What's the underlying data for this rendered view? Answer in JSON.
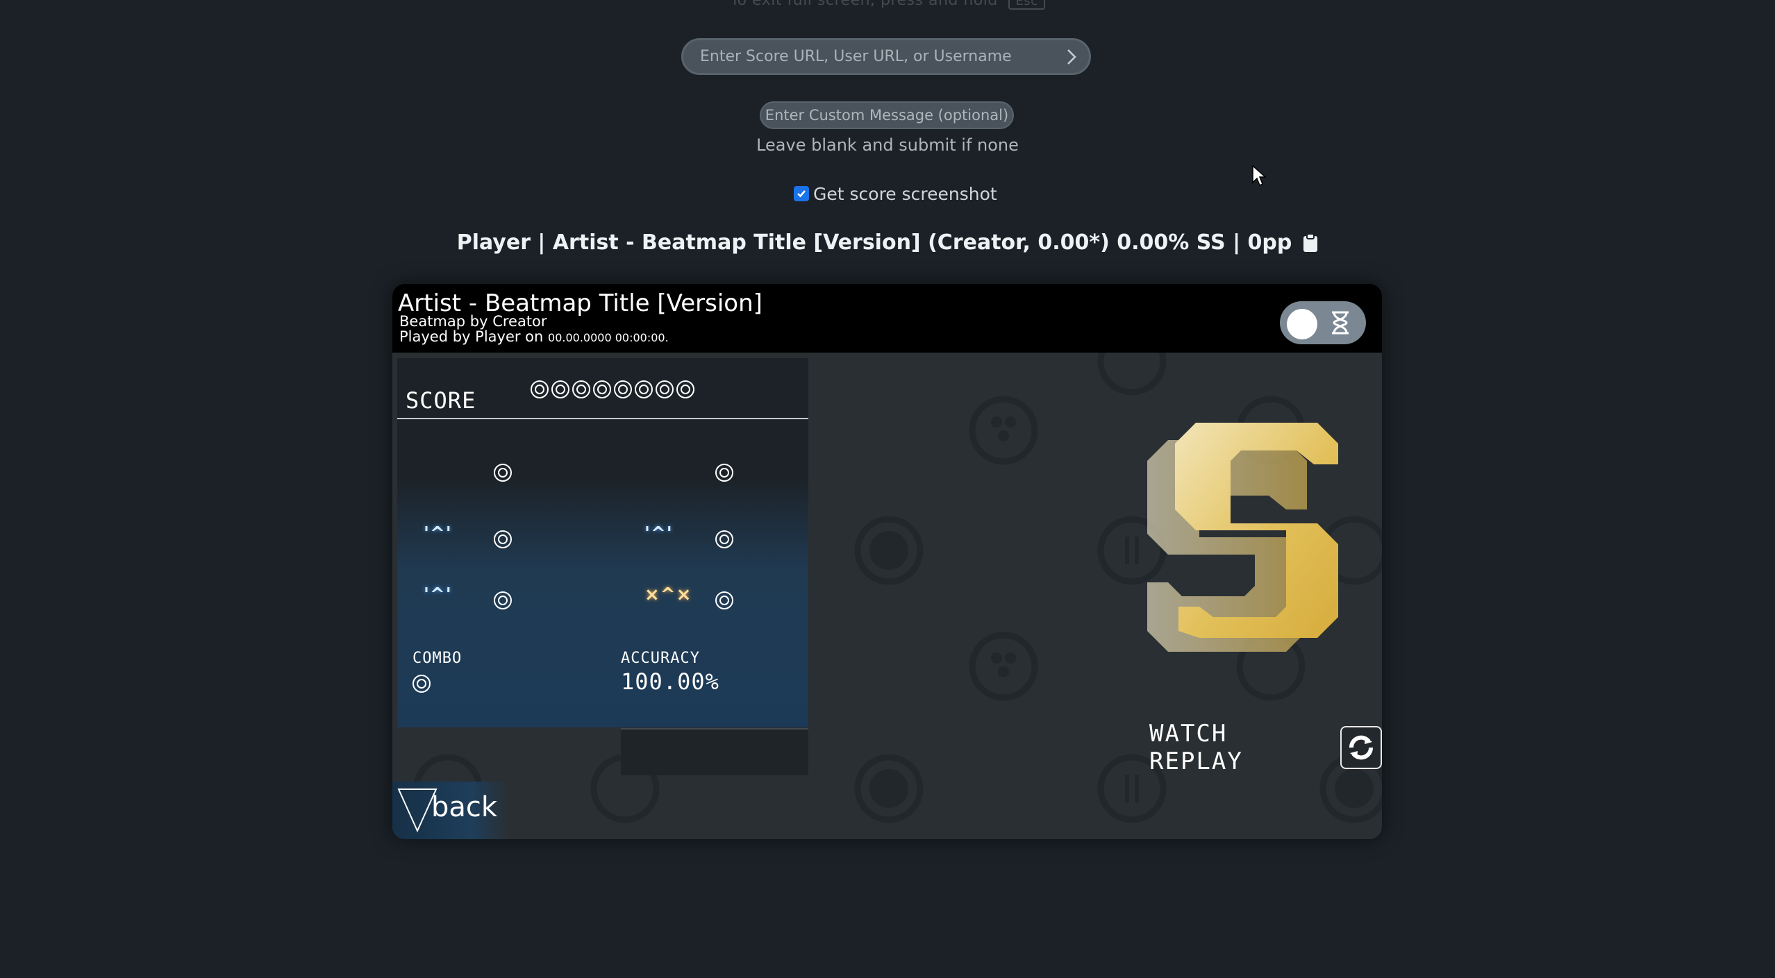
{
  "hint": {
    "text": "To exit full screen, press and hold",
    "key": "Esc"
  },
  "url_input": {
    "placeholder": "Enter Score URL, User URL, or Username"
  },
  "message_input": {
    "placeholder": "Enter Custom Message (optional)",
    "help": "Leave blank and submit if none"
  },
  "screenshot_option": {
    "label": "Get score screenshot",
    "checked": true
  },
  "summary": {
    "text": "Player | Artist - Beatmap Title [Version] (Creator, 0.00*) 0.00% SS | 0pp"
  },
  "card": {
    "title": "Artist - Beatmap Title [Version]",
    "mapper_line": "Beatmap by Creator",
    "played_by": "Played by Player on ",
    "played_date": "00.00.0000 00:00:00."
  },
  "results": {
    "score_label": "SCORE",
    "score_digits": 8,
    "combo_label": "COMBO",
    "accuracy_label": "ACCURACY",
    "accuracy_value": "100.00%",
    "watch_replay": "WATCH REPLAY",
    "back": "back",
    "rank": "S"
  },
  "colors": {
    "background": "#1b2127",
    "checkbox": "#1a73e8",
    "rank_gold": "#e6c463"
  },
  "icons": [
    "chevron-right-icon",
    "clipboard-icon",
    "hourglass-icon",
    "replay-icon",
    "back-triangle-icon",
    "cursor-icon"
  ]
}
